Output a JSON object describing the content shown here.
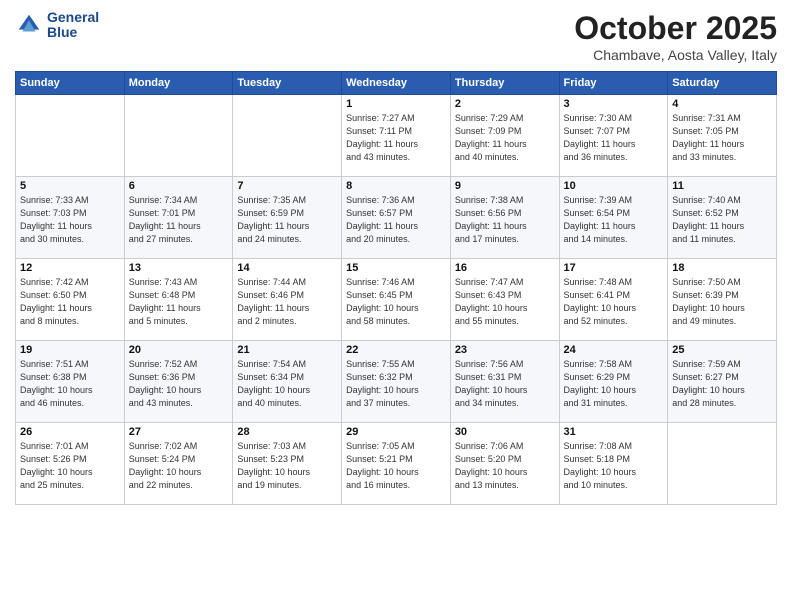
{
  "header": {
    "logo_line1": "General",
    "logo_line2": "Blue",
    "month": "October 2025",
    "location": "Chambave, Aosta Valley, Italy"
  },
  "weekdays": [
    "Sunday",
    "Monday",
    "Tuesday",
    "Wednesday",
    "Thursday",
    "Friday",
    "Saturday"
  ],
  "weeks": [
    [
      {
        "day": "",
        "info": ""
      },
      {
        "day": "",
        "info": ""
      },
      {
        "day": "",
        "info": ""
      },
      {
        "day": "1",
        "info": "Sunrise: 7:27 AM\nSunset: 7:11 PM\nDaylight: 11 hours\nand 43 minutes."
      },
      {
        "day": "2",
        "info": "Sunrise: 7:29 AM\nSunset: 7:09 PM\nDaylight: 11 hours\nand 40 minutes."
      },
      {
        "day": "3",
        "info": "Sunrise: 7:30 AM\nSunset: 7:07 PM\nDaylight: 11 hours\nand 36 minutes."
      },
      {
        "day": "4",
        "info": "Sunrise: 7:31 AM\nSunset: 7:05 PM\nDaylight: 11 hours\nand 33 minutes."
      }
    ],
    [
      {
        "day": "5",
        "info": "Sunrise: 7:33 AM\nSunset: 7:03 PM\nDaylight: 11 hours\nand 30 minutes."
      },
      {
        "day": "6",
        "info": "Sunrise: 7:34 AM\nSunset: 7:01 PM\nDaylight: 11 hours\nand 27 minutes."
      },
      {
        "day": "7",
        "info": "Sunrise: 7:35 AM\nSunset: 6:59 PM\nDaylight: 11 hours\nand 24 minutes."
      },
      {
        "day": "8",
        "info": "Sunrise: 7:36 AM\nSunset: 6:57 PM\nDaylight: 11 hours\nand 20 minutes."
      },
      {
        "day": "9",
        "info": "Sunrise: 7:38 AM\nSunset: 6:56 PM\nDaylight: 11 hours\nand 17 minutes."
      },
      {
        "day": "10",
        "info": "Sunrise: 7:39 AM\nSunset: 6:54 PM\nDaylight: 11 hours\nand 14 minutes."
      },
      {
        "day": "11",
        "info": "Sunrise: 7:40 AM\nSunset: 6:52 PM\nDaylight: 11 hours\nand 11 minutes."
      }
    ],
    [
      {
        "day": "12",
        "info": "Sunrise: 7:42 AM\nSunset: 6:50 PM\nDaylight: 11 hours\nand 8 minutes."
      },
      {
        "day": "13",
        "info": "Sunrise: 7:43 AM\nSunset: 6:48 PM\nDaylight: 11 hours\nand 5 minutes."
      },
      {
        "day": "14",
        "info": "Sunrise: 7:44 AM\nSunset: 6:46 PM\nDaylight: 11 hours\nand 2 minutes."
      },
      {
        "day": "15",
        "info": "Sunrise: 7:46 AM\nSunset: 6:45 PM\nDaylight: 10 hours\nand 58 minutes."
      },
      {
        "day": "16",
        "info": "Sunrise: 7:47 AM\nSunset: 6:43 PM\nDaylight: 10 hours\nand 55 minutes."
      },
      {
        "day": "17",
        "info": "Sunrise: 7:48 AM\nSunset: 6:41 PM\nDaylight: 10 hours\nand 52 minutes."
      },
      {
        "day": "18",
        "info": "Sunrise: 7:50 AM\nSunset: 6:39 PM\nDaylight: 10 hours\nand 49 minutes."
      }
    ],
    [
      {
        "day": "19",
        "info": "Sunrise: 7:51 AM\nSunset: 6:38 PM\nDaylight: 10 hours\nand 46 minutes."
      },
      {
        "day": "20",
        "info": "Sunrise: 7:52 AM\nSunset: 6:36 PM\nDaylight: 10 hours\nand 43 minutes."
      },
      {
        "day": "21",
        "info": "Sunrise: 7:54 AM\nSunset: 6:34 PM\nDaylight: 10 hours\nand 40 minutes."
      },
      {
        "day": "22",
        "info": "Sunrise: 7:55 AM\nSunset: 6:32 PM\nDaylight: 10 hours\nand 37 minutes."
      },
      {
        "day": "23",
        "info": "Sunrise: 7:56 AM\nSunset: 6:31 PM\nDaylight: 10 hours\nand 34 minutes."
      },
      {
        "day": "24",
        "info": "Sunrise: 7:58 AM\nSunset: 6:29 PM\nDaylight: 10 hours\nand 31 minutes."
      },
      {
        "day": "25",
        "info": "Sunrise: 7:59 AM\nSunset: 6:27 PM\nDaylight: 10 hours\nand 28 minutes."
      }
    ],
    [
      {
        "day": "26",
        "info": "Sunrise: 7:01 AM\nSunset: 5:26 PM\nDaylight: 10 hours\nand 25 minutes."
      },
      {
        "day": "27",
        "info": "Sunrise: 7:02 AM\nSunset: 5:24 PM\nDaylight: 10 hours\nand 22 minutes."
      },
      {
        "day": "28",
        "info": "Sunrise: 7:03 AM\nSunset: 5:23 PM\nDaylight: 10 hours\nand 19 minutes."
      },
      {
        "day": "29",
        "info": "Sunrise: 7:05 AM\nSunset: 5:21 PM\nDaylight: 10 hours\nand 16 minutes."
      },
      {
        "day": "30",
        "info": "Sunrise: 7:06 AM\nSunset: 5:20 PM\nDaylight: 10 hours\nand 13 minutes."
      },
      {
        "day": "31",
        "info": "Sunrise: 7:08 AM\nSunset: 5:18 PM\nDaylight: 10 hours\nand 10 minutes."
      },
      {
        "day": "",
        "info": ""
      }
    ]
  ]
}
